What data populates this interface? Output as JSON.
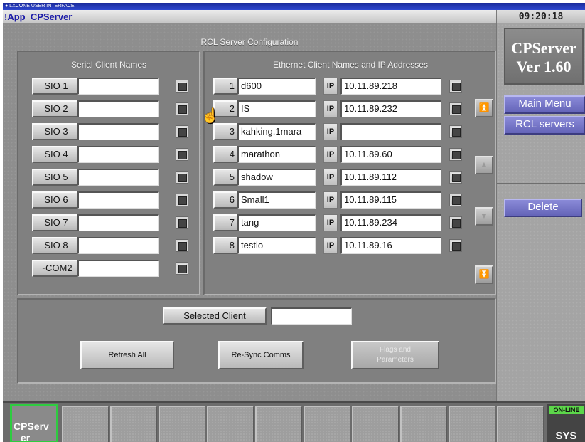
{
  "os_strip": {
    "text": "● LXCONE USER INTERFACE"
  },
  "window": {
    "title": "!App_CPServer",
    "clock": "09:20:18"
  },
  "main": {
    "title": "RCL Server Configuration",
    "serial_header": "Serial Client Names",
    "ethernet_header": "Ethernet Client Names and IP Addresses",
    "serial_clients": [
      {
        "label": "SIO 1",
        "value": ""
      },
      {
        "label": "SIO 2",
        "value": ""
      },
      {
        "label": "SIO 3",
        "value": ""
      },
      {
        "label": "SIO 4",
        "value": ""
      },
      {
        "label": "SIO 5",
        "value": ""
      },
      {
        "label": "SIO 6",
        "value": ""
      },
      {
        "label": "SIO 7",
        "value": ""
      },
      {
        "label": "SIO 8",
        "value": ""
      },
      {
        "label": "~COM2",
        "value": ""
      }
    ],
    "ip_tag": "IP",
    "ethernet_clients": [
      {
        "num": "1",
        "name": "d600",
        "ip": "10.11.89.218"
      },
      {
        "num": "2",
        "name": "IS",
        "ip": "10.11.89.232"
      },
      {
        "num": "3",
        "name": "kahking.1mara",
        "ip": ""
      },
      {
        "num": "4",
        "name": "marathon",
        "ip": "10.11.89.60"
      },
      {
        "num": "5",
        "name": "shadow",
        "ip": "10.11.89.112"
      },
      {
        "num": "6",
        "name": "Small1",
        "ip": "10.11.89.115"
      },
      {
        "num": "7",
        "name": "tang",
        "ip": "10.11.89.234"
      },
      {
        "num": "8",
        "name": "testlo",
        "ip": "10.11.89.16"
      }
    ],
    "selected_client_label": "Selected Client",
    "selected_client_value": "",
    "refresh_label": "Refresh All",
    "resync_label": "Re-Sync Comms",
    "flags_label_line1": "Flags and",
    "flags_label_line2": "Parameters"
  },
  "side": {
    "app_name": "CPServer",
    "version": "Ver 1.60",
    "menu": [
      "Main Menu",
      "RCL servers"
    ],
    "delete_label": "Delete"
  },
  "bottom": {
    "app_tile_line1": "CPServ",
    "app_tile_line2": "er",
    "status_badge": "ON-LINE",
    "sys_label": "SYS"
  },
  "icons": {
    "up_double": "double-up-arrow-icon",
    "up": "up-arrow-icon",
    "down": "down-arrow-icon",
    "down_double": "double-down-arrow-icon",
    "cursor": "hand-cursor-icon"
  },
  "colors": {
    "menu_accent": "#6f6fc4",
    "online_badge": "#5cd64a",
    "app_tile_border": "#2ecc40",
    "title_text": "#1c1ca8"
  }
}
